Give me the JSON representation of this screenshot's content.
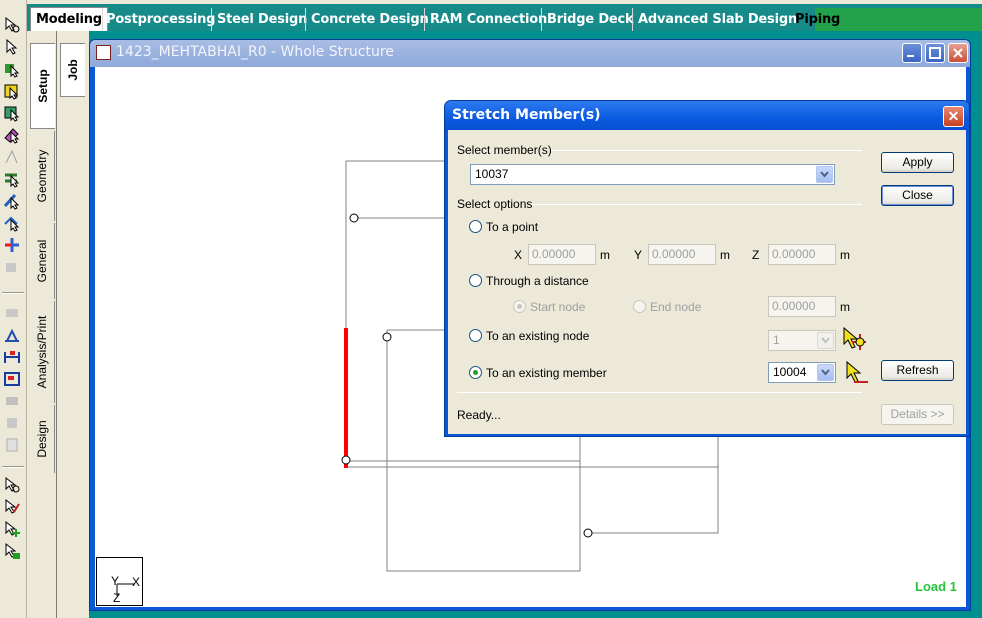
{
  "module_tabs": [
    {
      "label": "Modeling",
      "active": true
    },
    {
      "label": "Postprocessing"
    },
    {
      "label": "Steel Design"
    },
    {
      "label": "Concrete Design"
    },
    {
      "label": "RAM Connection"
    },
    {
      "label": "Bridge Deck"
    },
    {
      "label": "Advanced Slab Design"
    },
    {
      "label": "Piping"
    }
  ],
  "page_tabs": [
    {
      "label": "Setup",
      "active": true
    },
    {
      "label": "Geometry"
    },
    {
      "label": "General"
    },
    {
      "label": "Analysis/Print"
    },
    {
      "label": "Design"
    }
  ],
  "sub_tab": {
    "label": "Job"
  },
  "window": {
    "title": "1423_MEHTABHAI_R0 - Whole Structure",
    "load_label": "Load 1",
    "axis": {
      "y": "Y",
      "x": "X",
      "z": "Z"
    }
  },
  "dialog": {
    "title": "Stretch Member(s)",
    "select_group": "Select member(s)",
    "member_value": "10037",
    "options_group": "Select options",
    "to_point": "To a point",
    "coords": {
      "x_label": "X",
      "x_value": "0.00000",
      "x_unit": "m",
      "y_label": "Y",
      "y_value": "0.00000",
      "y_unit": "m",
      "z_label": "Z",
      "z_value": "0.00000",
      "z_unit": "m"
    },
    "through_distance": "Through a distance",
    "start_node": "Start node",
    "end_node": "End node",
    "distance_value": "0.00000",
    "distance_unit": "m",
    "to_node": "To an existing node",
    "node_value": "1",
    "to_member": "To an existing member",
    "member_target": "10004",
    "apply": "Apply",
    "close": "Close",
    "refresh": "Refresh",
    "details": "Details >>",
    "status": "Ready...",
    "selected_option": "to_member"
  },
  "colors": {
    "highlight_member": "#ff0000",
    "load_label": "#26c43a",
    "title_bar": "#0a58d6"
  }
}
